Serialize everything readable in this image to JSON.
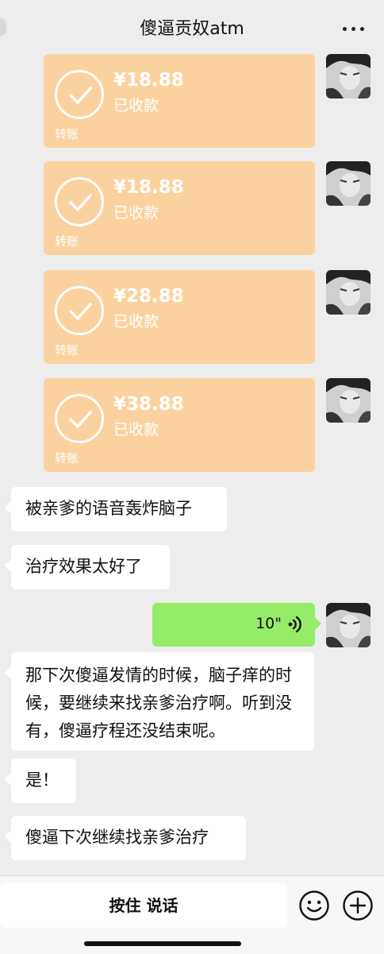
{
  "header": {
    "title": "傻逼贡奴atm"
  },
  "transfers": [
    {
      "amount": "¥18.88",
      "status": "已收款",
      "label": "转账"
    },
    {
      "amount": "¥18.88",
      "status": "已收款",
      "label": "转账"
    },
    {
      "amount": "¥28.88",
      "status": "已收款",
      "label": "转账"
    },
    {
      "amount": "¥38.88",
      "status": "已收款",
      "label": "转账"
    }
  ],
  "messages": [
    {
      "text": "被亲爹的语音轰炸脑子"
    },
    {
      "text": "治疗效果太好了"
    },
    {
      "voice_duration": "10\""
    },
    {
      "text": "那下次傻逼发情的时候，脑子痒的时候，要继续来找亲爹治疗啊。听到没有，傻逼疗程还没结束呢。"
    },
    {
      "text": "是！"
    },
    {
      "text": "傻逼下次继续找亲爹治疗"
    }
  ],
  "input": {
    "hold_to_talk": "按住 说话"
  },
  "icons": {
    "back": "back-icon",
    "more": "more-icon",
    "check": "check-circle-icon",
    "voice": "voice-wave-icon",
    "emoji": "emoji-icon",
    "plus": "plus-icon"
  },
  "colors": {
    "transfer_bg": "#fbd29f",
    "voice_bg": "#95ec69",
    "chat_bg": "#ededed"
  }
}
